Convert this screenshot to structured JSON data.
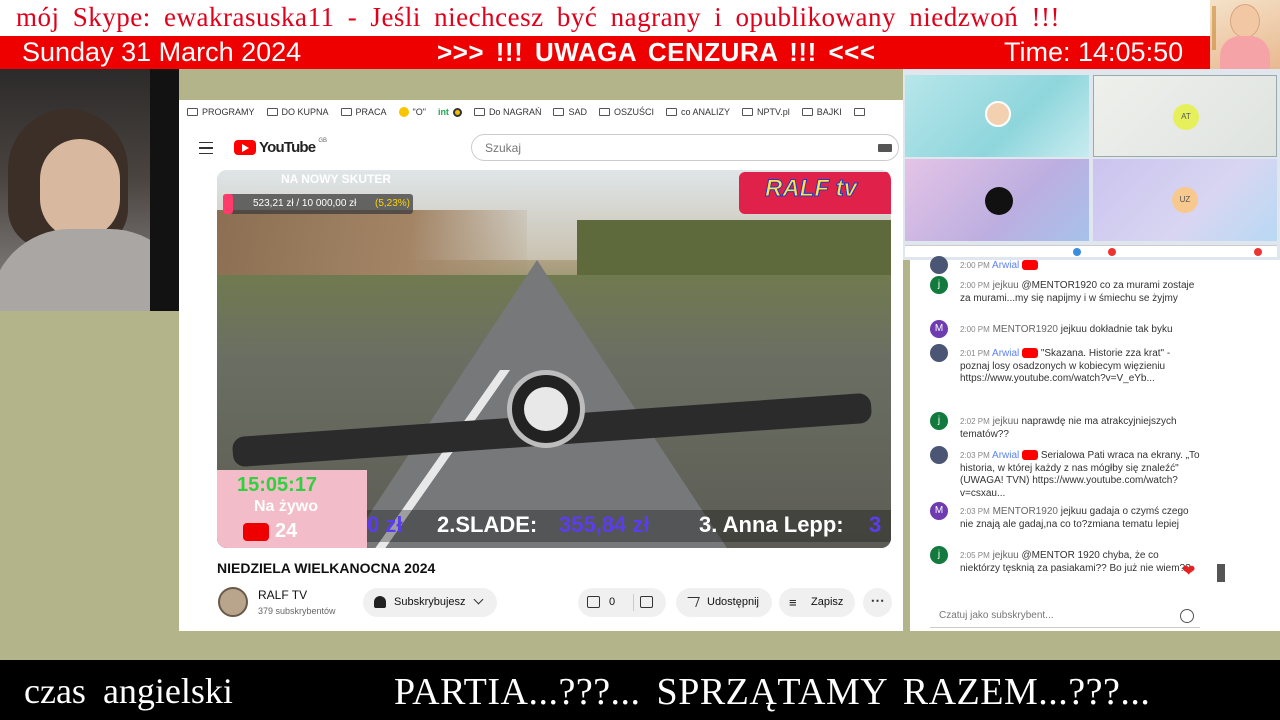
{
  "overlay": {
    "top_banner": "mój Skype: ewakrasuska11  - Jeśli  niechcesz  być  nagrany  i  opublikowany  niedzwoń !!!",
    "date": "Sunday 31 March 2024",
    "warning": ">>> !!! UWAGA  CENZURA !!! <<<",
    "time": "Time: 14:05:50",
    "bottom_left": "czas  angielski",
    "bottom_right": "PARTIA...???...  SPRZĄTAMY  RAZEM...???..."
  },
  "bookmarks": [
    {
      "label": "PROGRAMY",
      "icon": "folder-icon"
    },
    {
      "label": "DO KUPNA",
      "icon": "folder-icon"
    },
    {
      "label": "PRACA",
      "icon": "folder-icon"
    },
    {
      "label": "\"O\"",
      "icon": "emoji-icon"
    },
    {
      "label": "int",
      "icon": "site-icon"
    },
    {
      "label": "Do NAGRAŃ",
      "icon": "folder-icon"
    },
    {
      "label": "SAD",
      "icon": "folder-icon"
    },
    {
      "label": "OSZUŚCI",
      "icon": "folder-icon"
    },
    {
      "label": "co ANALIZY",
      "icon": "folder-icon"
    },
    {
      "label": "NPTV.pl",
      "icon": "folder-icon"
    },
    {
      "label": "BAJKI",
      "icon": "folder-icon"
    }
  ],
  "youtube": {
    "logo": "YouTube",
    "region": "GB",
    "search_placeholder": "Szukaj",
    "video_title": "NIEDZIELA WIELKANOCNA 2024",
    "channel": "RALF TV",
    "subscribers": "379 subskrybentów",
    "subscribe_label": "Subskrybujesz",
    "likes": "0",
    "share_label": "Udostępnij",
    "save_label": "Zapisz"
  },
  "video_overlay": {
    "goal_title": "NA NOWY SKUTER",
    "goal_amount": "523,21 zł / 10 000,00 zł",
    "goal_pct": "(5,23%)",
    "goal_progress": 0.0523,
    "brand": "RALF tv",
    "clock": "15:05:17",
    "live": "Na żywo",
    "live_channel": "24",
    "ticker_prefix": "0 zł",
    "ticker_second_name": "2.SLADE:",
    "ticker_second_value": "355,84 zł",
    "ticker_third": "3. Anna Lepp:",
    "ticker_third_tail": "3"
  },
  "stream_tiles": [
    {
      "initials": ""
    },
    {
      "initials": "AT"
    },
    {
      "initials": ""
    },
    {
      "initials": "UZ"
    }
  ],
  "chat": {
    "messages": [
      {
        "avatar": "",
        "time": "2:00 PM",
        "author": "Arwial",
        "text": ""
      },
      {
        "avatar": "j",
        "time": "2:00 PM",
        "author": "jejkuu",
        "text": "@MENTOR1920 co za murami zostaje za murami...my się napijmy i w śmiechu se żyjmy"
      },
      {
        "avatar": "M",
        "time": "2:00 PM",
        "author": "MENTOR1920",
        "text": "jejkuu dokładnie tak byku"
      },
      {
        "avatar": "",
        "time": "2:01 PM",
        "author": "Arwial",
        "text": "\"Skazana. Historie zza krat\" - poznaj losy osadzonych w kobiecym więzieniu https://www.youtube.com/watch?v=V_eYb..."
      },
      {
        "avatar": "j",
        "time": "2:02 PM",
        "author": "jejkuu",
        "text": "naprawdę nie ma atrakcyjniejszych tematów??"
      },
      {
        "avatar": "",
        "time": "2:03 PM",
        "author": "Arwial",
        "text": "Serialowa Pati wraca na ekrany. „To historia, w której każdy z nas mógłby się znaleźć\" (UWAGA! TVN) https://www.youtube.com/watch?v=csxau..."
      },
      {
        "avatar": "M",
        "time": "2:03 PM",
        "author": "MENTOR1920",
        "text": "jejkuu gadaja o czymś czego nie znają ale gadaj,na co to?zmiana tematu lepiej"
      },
      {
        "avatar": "j",
        "time": "2:05 PM",
        "author": "jejkuu",
        "text": "@MENTOR 1920 chyba, że co niektórzy tęsknią za pasiakami?? Bo już nie wiem?? "
      }
    ],
    "input_placeholder": "Czatuj jako subskrybent..."
  }
}
